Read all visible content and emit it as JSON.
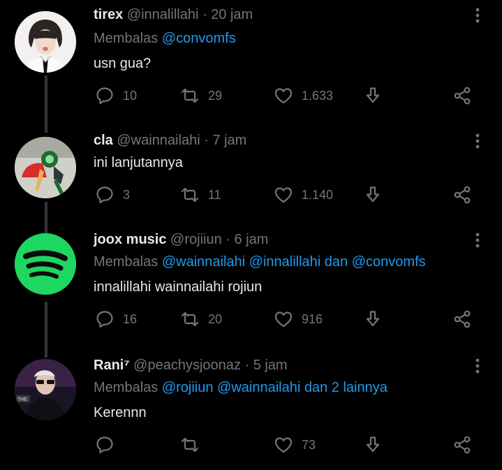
{
  "tweets": [
    {
      "name": "tirex",
      "handle": "@innalillahi",
      "time": "20 jam",
      "reply_prefix": "Membalas",
      "reply_mentions": "@convomfs",
      "reply_suffix": "",
      "text": "usn gua?",
      "replies": "10",
      "retweets": "29",
      "likes": "1.633"
    },
    {
      "name": "cla",
      "handle": "@wainnailahi",
      "time": "7 jam",
      "text": "ini lanjutannya",
      "replies": "3",
      "retweets": "11",
      "likes": "1.140"
    },
    {
      "name": "joox music",
      "handle": "@rojiiun",
      "time": "6 jam",
      "reply_prefix": "Membalas",
      "reply_mentions": "@wainnailahi @innalillahi",
      "reply_mid": "dan",
      "reply_mentions2": "@convomfs",
      "text": "innalillahi wainnailahi rojiun",
      "replies": "16",
      "retweets": "20",
      "likes": "916"
    },
    {
      "name": "Rani⁷",
      "handle": "@peachysjoonaz",
      "time": "5 jam",
      "reply_prefix": "Membalas",
      "reply_mentions": "@rojiiun @wainnailahi dan 2 lainnya",
      "text": "Kerennn",
      "replies": "",
      "retweets": "",
      "likes": "73"
    }
  ],
  "separator": "·",
  "avatar_badge_text": "THE",
  "colors": {
    "background": "#000000",
    "accent": "#1d9bf0",
    "muted": "#71767b",
    "spotify_green": "#1ed760"
  },
  "icons": [
    "reply-icon",
    "retweet-icon",
    "like-icon",
    "download-icon",
    "share-icon",
    "more-icon"
  ]
}
